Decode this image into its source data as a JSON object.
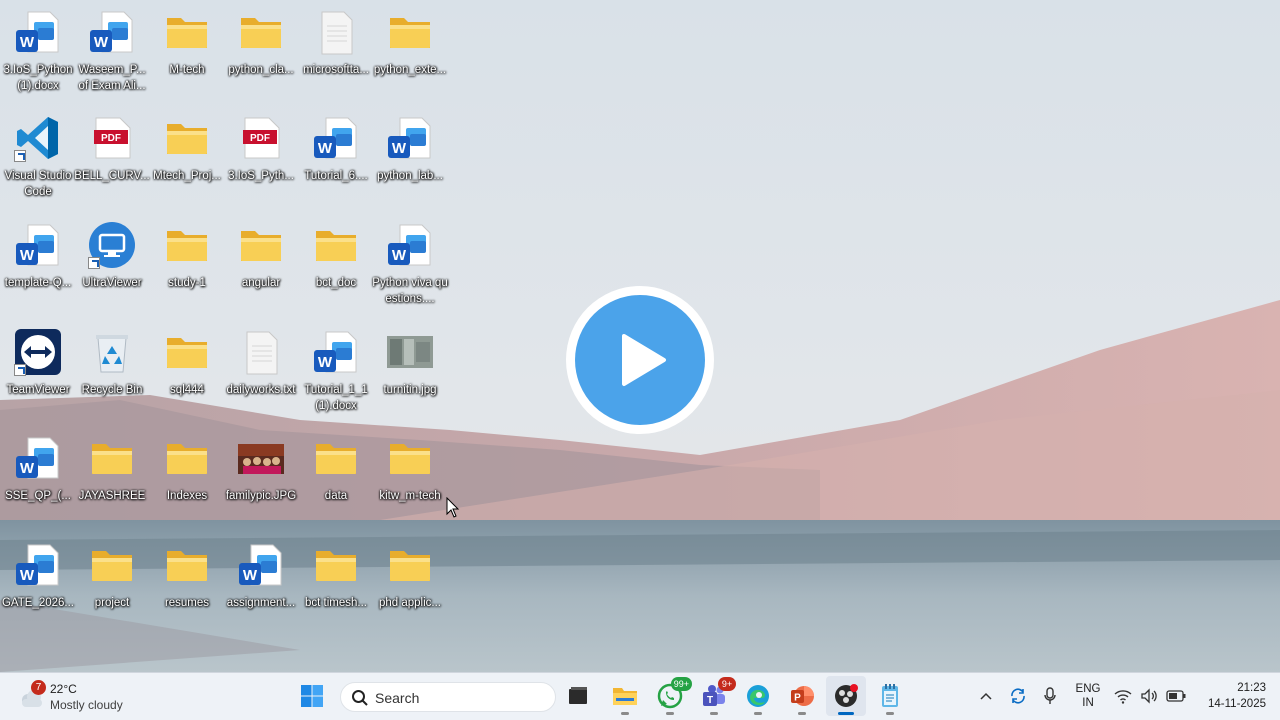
{
  "desktop": {
    "icons": [
      {
        "label": "3.IoS_Python (1).docx",
        "type": "word"
      },
      {
        "label": "Waseem_P... of Exam Ali...",
        "type": "word"
      },
      {
        "label": "M-tech",
        "type": "folder"
      },
      {
        "label": "python_cla...",
        "type": "folder"
      },
      {
        "label": "microsoftta...",
        "type": "file"
      },
      {
        "label": "python_exte...",
        "type": "folder"
      },
      {
        "label": "Visual Studio Code",
        "type": "vscode"
      },
      {
        "label": "BELL_CURV...",
        "type": "pdf"
      },
      {
        "label": "Mtech_Proj...",
        "type": "folder"
      },
      {
        "label": "3.IoS_Pyth...",
        "type": "pdf"
      },
      {
        "label": "Tutorial_6....",
        "type": "word"
      },
      {
        "label": "python_lab...",
        "type": "word"
      },
      {
        "label": "template-Q...",
        "type": "word"
      },
      {
        "label": "UltraViewer",
        "type": "ultraviewer"
      },
      {
        "label": "study-1",
        "type": "folder"
      },
      {
        "label": "angular",
        "type": "folder"
      },
      {
        "label": "bct_doc",
        "type": "folder"
      },
      {
        "label": "Python viva questions....",
        "type": "word"
      },
      {
        "label": "TeamViewer",
        "type": "teamviewer"
      },
      {
        "label": "Recycle Bin",
        "type": "recycle"
      },
      {
        "label": "sql444",
        "type": "folder"
      },
      {
        "label": "dailyworks.txt",
        "type": "file"
      },
      {
        "label": "Tutorial_1_1 (1).docx",
        "type": "word"
      },
      {
        "label": "turnitin.jpg",
        "type": "image"
      },
      {
        "label": "SSE_QP_(...",
        "type": "word"
      },
      {
        "label": "JAYASHREE",
        "type": "folder"
      },
      {
        "label": "Indexes",
        "type": "folder"
      },
      {
        "label": "familypic.JPG",
        "type": "photo"
      },
      {
        "label": "data",
        "type": "folder"
      },
      {
        "label": "kitw_m-tech",
        "type": "folder"
      },
      {
        "label": "GATE_2026...",
        "type": "word"
      },
      {
        "label": "project",
        "type": "folder"
      },
      {
        "label": "resumes",
        "type": "folder"
      },
      {
        "label": "assignment...",
        "type": "word"
      },
      {
        "label": "bct timesh...",
        "type": "folder"
      },
      {
        "label": "phd applic...",
        "type": "folder"
      }
    ]
  },
  "overlay": {
    "icon": "play-icon"
  },
  "taskbar": {
    "weather": {
      "badge": "7",
      "temperature": "22°C",
      "condition": "Mostly cloudy"
    },
    "search_label": "Search",
    "apps": [
      {
        "name": "start-button",
        "icon": "windows-logo-icon",
        "badge": ""
      },
      {
        "name": "task-view-button",
        "icon": "task-view-icon",
        "badge": ""
      },
      {
        "name": "file-explorer-button",
        "icon": "folder-icon",
        "badge": ""
      },
      {
        "name": "whatsapp-button",
        "icon": "whatsapp-icon",
        "badge": "99+"
      },
      {
        "name": "teams-button",
        "icon": "teams-icon",
        "badge": "9+"
      },
      {
        "name": "edge-button",
        "icon": "edge-icon",
        "badge": ""
      },
      {
        "name": "powerpoint-button",
        "icon": "powerpoint-icon",
        "badge": ""
      },
      {
        "name": "obs-button",
        "icon": "obs-icon",
        "badge": ""
      },
      {
        "name": "notepad-button",
        "icon": "notepad-icon",
        "badge": ""
      }
    ],
    "language": {
      "line1": "ENG",
      "line2": "IN"
    },
    "clock": {
      "time": "21:23",
      "date": "14-11-2025"
    }
  },
  "colors": {
    "accent": "#0067c0",
    "play_circle": "#4ba3ea",
    "folder": "#f6c84b",
    "word_blue": "#185abd",
    "pdf_red": "#c8102e"
  }
}
